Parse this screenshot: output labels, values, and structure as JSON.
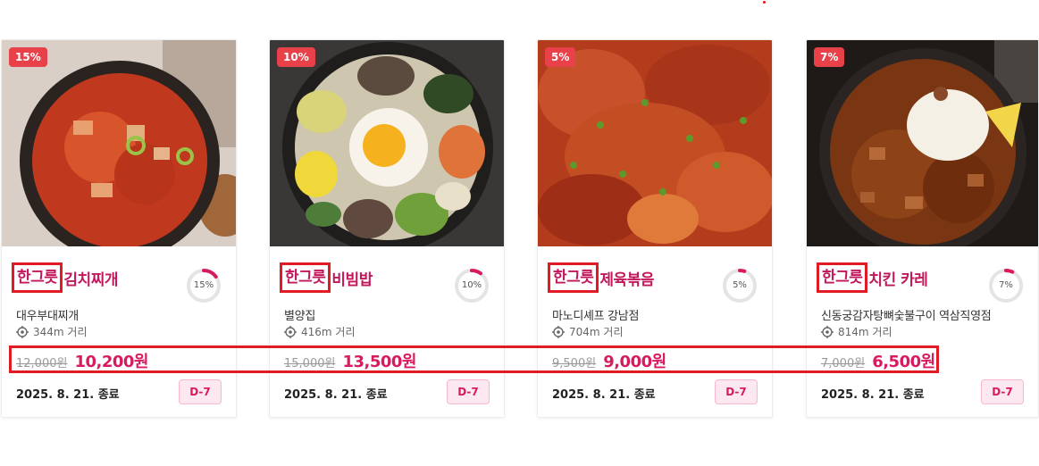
{
  "cards": [
    {
      "discount_badge": "15%",
      "brand_tag": "한그릇",
      "menu_name": "김치찌개",
      "progress_label": "15%",
      "progress_fraction": 0.15,
      "store_name": "대우부대찌개",
      "distance": "344m 거리",
      "original_price": "12,000원",
      "sale_price": "10,200원",
      "end_date": "2025. 8. 21. 종료",
      "dday": "D-7"
    },
    {
      "discount_badge": "10%",
      "brand_tag": "한그릇",
      "menu_name": "비빔밥",
      "progress_label": "10%",
      "progress_fraction": 0.1,
      "store_name": "별양집",
      "distance": "416m 거리",
      "original_price": "15,000원",
      "sale_price": "13,500원",
      "end_date": "2025. 8. 21. 종료",
      "dday": "D-7"
    },
    {
      "discount_badge": "5%",
      "brand_tag": "한그릇",
      "menu_name": "제육볶음",
      "progress_label": "5%",
      "progress_fraction": 0.05,
      "store_name": "마노디셰프 강남점",
      "distance": "704m 거리",
      "original_price": "9,500원",
      "sale_price": "9,000원",
      "end_date": "2025. 8. 21. 종료",
      "dday": "D-7"
    },
    {
      "discount_badge": "7%",
      "brand_tag": "한그릇",
      "menu_name": "치킨 카레",
      "progress_label": "7%",
      "progress_fraction": 0.07,
      "store_name": "신동궁감자탕뼈숯불구이 역삼직영점",
      "distance": "814m 거리",
      "original_price": "7,000원",
      "sale_price": "6,500원",
      "end_date": "2025. 8. 21. 종료",
      "dday": "D-7"
    }
  ],
  "colors": {
    "accent": "#d81b60",
    "badge_red": "#e8414a",
    "highlight_box": "#e01b24",
    "dday_bg": "#fde7f0"
  },
  "icons": {
    "location": "location-target-icon"
  }
}
